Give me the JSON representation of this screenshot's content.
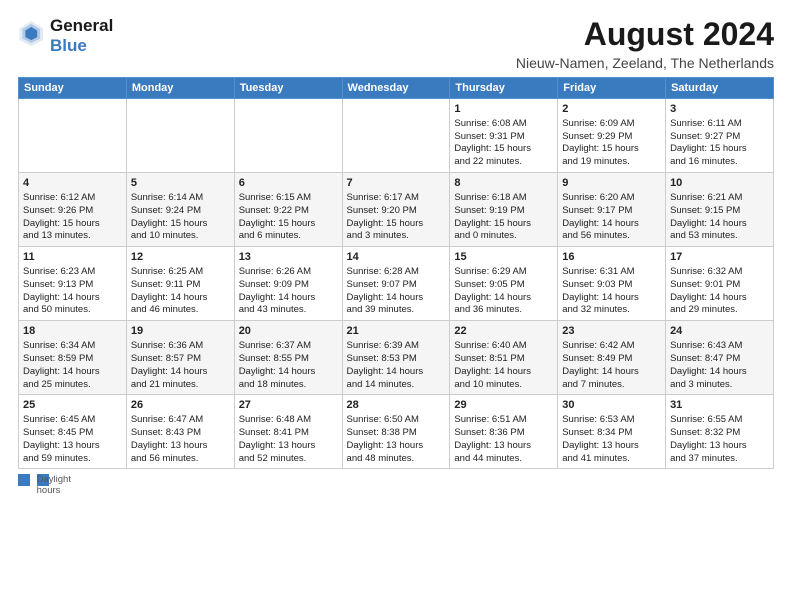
{
  "header": {
    "logo_line1": "General",
    "logo_line2": "Blue",
    "main_title": "August 2024",
    "subtitle": "Nieuw-Namen, Zeeland, The Netherlands"
  },
  "days_of_week": [
    "Sunday",
    "Monday",
    "Tuesday",
    "Wednesday",
    "Thursday",
    "Friday",
    "Saturday"
  ],
  "weeks": [
    [
      {
        "day": "",
        "lines": []
      },
      {
        "day": "",
        "lines": []
      },
      {
        "day": "",
        "lines": []
      },
      {
        "day": "",
        "lines": []
      },
      {
        "day": "1",
        "lines": [
          "Sunrise: 6:08 AM",
          "Sunset: 9:31 PM",
          "Daylight: 15 hours",
          "and 22 minutes."
        ]
      },
      {
        "day": "2",
        "lines": [
          "Sunrise: 6:09 AM",
          "Sunset: 9:29 PM",
          "Daylight: 15 hours",
          "and 19 minutes."
        ]
      },
      {
        "day": "3",
        "lines": [
          "Sunrise: 6:11 AM",
          "Sunset: 9:27 PM",
          "Daylight: 15 hours",
          "and 16 minutes."
        ]
      }
    ],
    [
      {
        "day": "4",
        "lines": [
          "Sunrise: 6:12 AM",
          "Sunset: 9:26 PM",
          "Daylight: 15 hours",
          "and 13 minutes."
        ]
      },
      {
        "day": "5",
        "lines": [
          "Sunrise: 6:14 AM",
          "Sunset: 9:24 PM",
          "Daylight: 15 hours",
          "and 10 minutes."
        ]
      },
      {
        "day": "6",
        "lines": [
          "Sunrise: 6:15 AM",
          "Sunset: 9:22 PM",
          "Daylight: 15 hours",
          "and 6 minutes."
        ]
      },
      {
        "day": "7",
        "lines": [
          "Sunrise: 6:17 AM",
          "Sunset: 9:20 PM",
          "Daylight: 15 hours",
          "and 3 minutes."
        ]
      },
      {
        "day": "8",
        "lines": [
          "Sunrise: 6:18 AM",
          "Sunset: 9:19 PM",
          "Daylight: 15 hours",
          "and 0 minutes."
        ]
      },
      {
        "day": "9",
        "lines": [
          "Sunrise: 6:20 AM",
          "Sunset: 9:17 PM",
          "Daylight: 14 hours",
          "and 56 minutes."
        ]
      },
      {
        "day": "10",
        "lines": [
          "Sunrise: 6:21 AM",
          "Sunset: 9:15 PM",
          "Daylight: 14 hours",
          "and 53 minutes."
        ]
      }
    ],
    [
      {
        "day": "11",
        "lines": [
          "Sunrise: 6:23 AM",
          "Sunset: 9:13 PM",
          "Daylight: 14 hours",
          "and 50 minutes."
        ]
      },
      {
        "day": "12",
        "lines": [
          "Sunrise: 6:25 AM",
          "Sunset: 9:11 PM",
          "Daylight: 14 hours",
          "and 46 minutes."
        ]
      },
      {
        "day": "13",
        "lines": [
          "Sunrise: 6:26 AM",
          "Sunset: 9:09 PM",
          "Daylight: 14 hours",
          "and 43 minutes."
        ]
      },
      {
        "day": "14",
        "lines": [
          "Sunrise: 6:28 AM",
          "Sunset: 9:07 PM",
          "Daylight: 14 hours",
          "and 39 minutes."
        ]
      },
      {
        "day": "15",
        "lines": [
          "Sunrise: 6:29 AM",
          "Sunset: 9:05 PM",
          "Daylight: 14 hours",
          "and 36 minutes."
        ]
      },
      {
        "day": "16",
        "lines": [
          "Sunrise: 6:31 AM",
          "Sunset: 9:03 PM",
          "Daylight: 14 hours",
          "and 32 minutes."
        ]
      },
      {
        "day": "17",
        "lines": [
          "Sunrise: 6:32 AM",
          "Sunset: 9:01 PM",
          "Daylight: 14 hours",
          "and 29 minutes."
        ]
      }
    ],
    [
      {
        "day": "18",
        "lines": [
          "Sunrise: 6:34 AM",
          "Sunset: 8:59 PM",
          "Daylight: 14 hours",
          "and 25 minutes."
        ]
      },
      {
        "day": "19",
        "lines": [
          "Sunrise: 6:36 AM",
          "Sunset: 8:57 PM",
          "Daylight: 14 hours",
          "and 21 minutes."
        ]
      },
      {
        "day": "20",
        "lines": [
          "Sunrise: 6:37 AM",
          "Sunset: 8:55 PM",
          "Daylight: 14 hours",
          "and 18 minutes."
        ]
      },
      {
        "day": "21",
        "lines": [
          "Sunrise: 6:39 AM",
          "Sunset: 8:53 PM",
          "Daylight: 14 hours",
          "and 14 minutes."
        ]
      },
      {
        "day": "22",
        "lines": [
          "Sunrise: 6:40 AM",
          "Sunset: 8:51 PM",
          "Daylight: 14 hours",
          "and 10 minutes."
        ]
      },
      {
        "day": "23",
        "lines": [
          "Sunrise: 6:42 AM",
          "Sunset: 8:49 PM",
          "Daylight: 14 hours",
          "and 7 minutes."
        ]
      },
      {
        "day": "24",
        "lines": [
          "Sunrise: 6:43 AM",
          "Sunset: 8:47 PM",
          "Daylight: 14 hours",
          "and 3 minutes."
        ]
      }
    ],
    [
      {
        "day": "25",
        "lines": [
          "Sunrise: 6:45 AM",
          "Sunset: 8:45 PM",
          "Daylight: 13 hours",
          "and 59 minutes."
        ]
      },
      {
        "day": "26",
        "lines": [
          "Sunrise: 6:47 AM",
          "Sunset: 8:43 PM",
          "Daylight: 13 hours",
          "and 56 minutes."
        ]
      },
      {
        "day": "27",
        "lines": [
          "Sunrise: 6:48 AM",
          "Sunset: 8:41 PM",
          "Daylight: 13 hours",
          "and 52 minutes."
        ]
      },
      {
        "day": "28",
        "lines": [
          "Sunrise: 6:50 AM",
          "Sunset: 8:38 PM",
          "Daylight: 13 hours",
          "and 48 minutes."
        ]
      },
      {
        "day": "29",
        "lines": [
          "Sunrise: 6:51 AM",
          "Sunset: 8:36 PM",
          "Daylight: 13 hours",
          "and 44 minutes."
        ]
      },
      {
        "day": "30",
        "lines": [
          "Sunrise: 6:53 AM",
          "Sunset: 8:34 PM",
          "Daylight: 13 hours",
          "and 41 minutes."
        ]
      },
      {
        "day": "31",
        "lines": [
          "Sunrise: 6:55 AM",
          "Sunset: 8:32 PM",
          "Daylight: 13 hours",
          "and 37 minutes."
        ]
      }
    ]
  ],
  "footer": {
    "daylight_label": "Daylight hours"
  }
}
